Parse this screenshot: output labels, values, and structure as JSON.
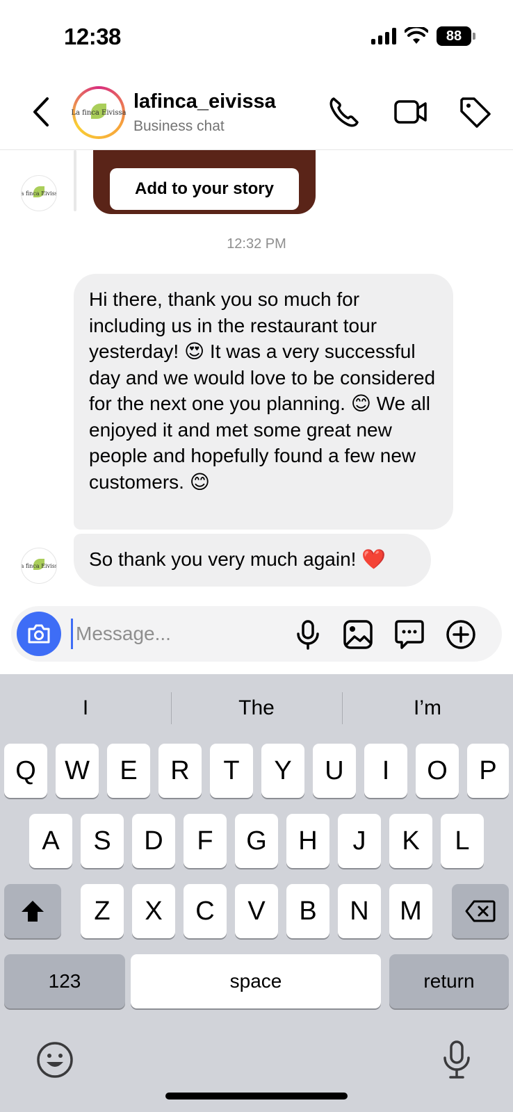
{
  "status_bar": {
    "time": "12:38",
    "battery": "88"
  },
  "header": {
    "username": "lafinca_eivissa",
    "subtitle": "Business chat",
    "avatar_text": "La finca Eivissa"
  },
  "chat": {
    "story_button": "Add to your story",
    "timestamp": "12:32 PM",
    "messages": [
      {
        "text": "Hi there, thank you so much for including us in the restaurant tour yesterday! 😍 It was a very successful day and we would love to be considered for the next one you planning. 😊 We all enjoyed it and met some great new people and hopefully found a few new customers. 😊"
      },
      {
        "text": "So thank you very much again! ❤️"
      }
    ]
  },
  "composer": {
    "placeholder": "Message..."
  },
  "keyboard": {
    "suggestions": [
      "I",
      "The",
      "I’m"
    ],
    "row1": [
      "Q",
      "W",
      "E",
      "R",
      "T",
      "Y",
      "U",
      "I",
      "O",
      "P"
    ],
    "row2": [
      "A",
      "S",
      "D",
      "F",
      "G",
      "H",
      "J",
      "K",
      "L"
    ],
    "row3": [
      "Z",
      "X",
      "C",
      "V",
      "B",
      "N",
      "M"
    ],
    "numbers": "123",
    "space": "space",
    "return": "return"
  },
  "colors": {
    "accent": "#3e6df6",
    "bubble": "#efeff0",
    "keyboard_bg": "#d1d3d9"
  }
}
